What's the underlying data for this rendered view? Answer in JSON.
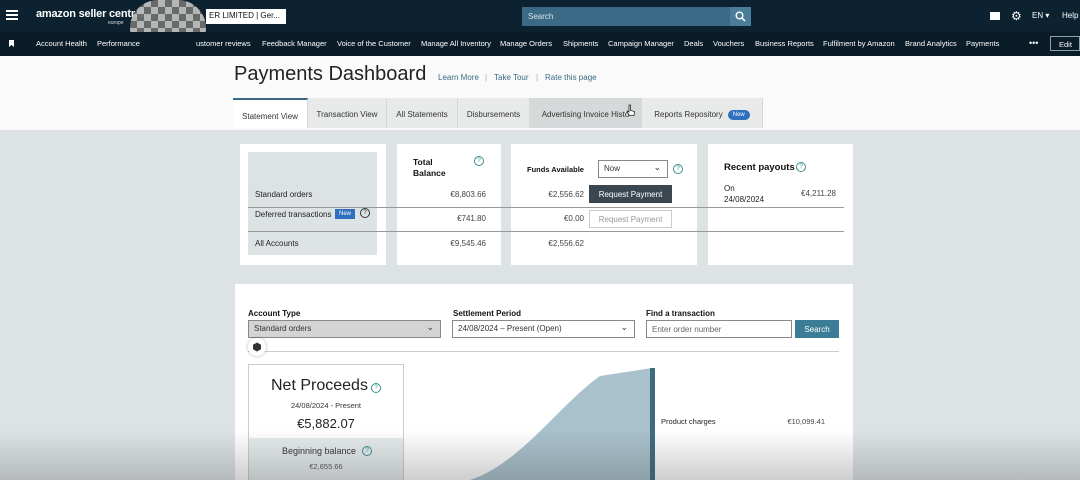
{
  "topbar": {
    "logo": "amazon seller central",
    "logo_sub": "europe",
    "account": "ER LIMITED | Ger...",
    "search_placeholder": "Search",
    "language": "EN",
    "help": "Help"
  },
  "nav": {
    "items": [
      "Account Health",
      "Performance",
      "ustomer reviews",
      "Feedback Manager",
      "Voice of the Customer",
      "Manage All Inventory",
      "Manage Orders",
      "Shipments",
      "Campaign Manager",
      "Deals",
      "Vouchers",
      "Business Reports",
      "Fulfilment by Amazon",
      "Brand Analytics",
      "Payments"
    ],
    "more": "•••",
    "edit": "Edit"
  },
  "header": {
    "title": "Payments Dashboard",
    "links": [
      "Learn More",
      "Take Tour",
      "Rate this page"
    ]
  },
  "tabs": [
    {
      "label": "Statement View"
    },
    {
      "label": "Transaction View"
    },
    {
      "label": "All Statements"
    },
    {
      "label": "Disbursements"
    },
    {
      "label": "Advertising Invoice Histo"
    },
    {
      "label": "Reports Repository",
      "badge": "New"
    }
  ],
  "balances": {
    "rows": [
      "Standard orders",
      "Deferred transactions",
      "All Accounts"
    ],
    "deferred_badge": "New",
    "total_title": "Total Balance",
    "total_values": [
      "€8,803.66",
      "€741.80",
      "€9,545.46"
    ],
    "funds_title": "Funds Available",
    "funds_select": "Now",
    "funds_values": [
      "€2,556.62",
      "€0.00",
      "€2,556.62"
    ],
    "request_payment": "Request Payment",
    "request_payment_disabled": "Request Payment"
  },
  "payouts": {
    "title": "Recent payouts",
    "date_prefix": "On",
    "date": "24/08/2024",
    "amount": "€4,211.28"
  },
  "filters": {
    "account_type_label": "Account Type",
    "account_type_value": "Standard orders",
    "settlement_label": "Settlement Period",
    "settlement_value": "24/08/2024 – Present (Open)",
    "find_label": "Find a transaction",
    "find_placeholder": "Enter order number",
    "search_button": "Search"
  },
  "net_proceeds": {
    "title": "Net Proceeds",
    "period": "24/08/2024 - Present",
    "amount": "€5,882.07",
    "beginning_label": "Beginning balance",
    "beginning_amount": "€2,655.66"
  },
  "breakdown": {
    "product_charges_label": "Product charges",
    "product_charges_amount": "€10,099.41"
  },
  "colors": {
    "topbar": "#0c2230",
    "accent": "#3b6a86",
    "badge": "#2f6fbf",
    "flow": "#a9c1cc",
    "flow_bar": "#3d6c7e"
  }
}
